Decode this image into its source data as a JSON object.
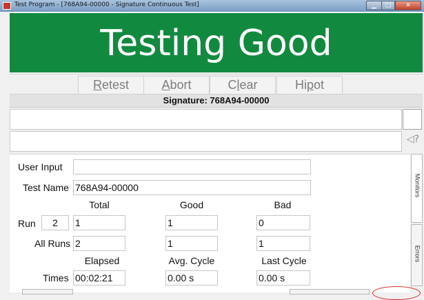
{
  "window": {
    "title": "Test Program - [768A94-00000 - Signature Continuous Test]"
  },
  "banner": {
    "status": "Testing Good"
  },
  "toolbar": [
    {
      "label": "Retest",
      "mn": "R",
      "rest": "etest"
    },
    {
      "label": "Abort",
      "mn": "A",
      "rest": "bort"
    },
    {
      "label": "Clear",
      "pre": "C",
      "mn": "l",
      "rest": "ear"
    },
    {
      "label": "Hipot",
      "pre": "Hi",
      "mn": "p",
      "rest": "ot"
    }
  ],
  "signature": "Signature: 768A94-00000",
  "side_tabs": {
    "monitors": "Monitors",
    "errors": "Errors"
  },
  "form": {
    "user_input_label": "User Input",
    "user_input_value": "",
    "test_name_label": "Test Name",
    "test_name_value": "768A94-00000"
  },
  "counts": {
    "headers": {
      "total": "Total",
      "good": "Good",
      "bad": "Bad"
    },
    "run_label": "Run",
    "run_number": "2",
    "run": {
      "total": "1",
      "good": "1",
      "bad": "0"
    },
    "all_runs_label": "All Runs",
    "all_runs": {
      "total": "2",
      "good": "1",
      "bad": "1"
    }
  },
  "times": {
    "headers": {
      "elapsed": "Elapsed",
      "avg_cycle": "Avg. Cycle",
      "last_cycle": "Last Cycle"
    },
    "label": "Times",
    "elapsed": "00:02:21",
    "avg_cycle": "0.00 s",
    "last_cycle": "0.00 s"
  },
  "colors": {
    "banner": "#118a3f",
    "banner_text": "#ffffff"
  }
}
